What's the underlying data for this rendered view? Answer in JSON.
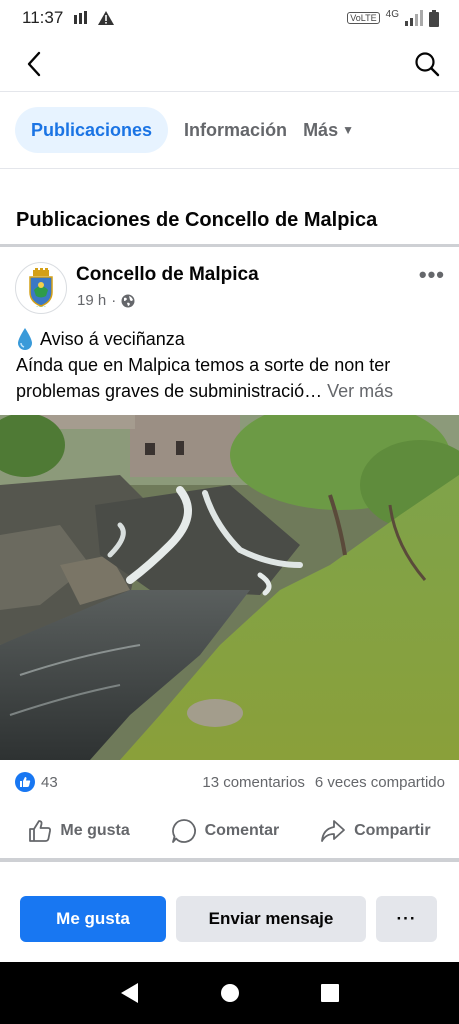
{
  "status_bar": {
    "time": "11:37",
    "volte": "VoLTE",
    "network": "4G"
  },
  "topnav": {
    "back_icon": "back-arrow-icon",
    "search_icon": "search-icon"
  },
  "tabs": [
    {
      "label": "Publicaciones",
      "active": true
    },
    {
      "label": "Información",
      "active": false
    },
    {
      "label": "Más",
      "active": false
    }
  ],
  "section_title": "Publicaciones de Concello de Malpica",
  "post": {
    "page_name": "Concello de Malpica",
    "time_ago": "19 h",
    "separator": "·",
    "line1": "Aviso á veciñanza",
    "line2": "Aínda que en Malpica temos a sorte de non ter",
    "line3": "problemas graves de subministració…",
    "see_more": "Ver más",
    "reaction_count": "43",
    "comments": "13 comentarios",
    "shares": "6 veces compartido",
    "actions": {
      "like": "Me gusta",
      "comment": "Comentar",
      "share": "Compartir"
    }
  },
  "bottom_bar": {
    "like_button": "Me gusta",
    "message_button": "Enviar mensaje",
    "more_button": "···"
  },
  "colors": {
    "accent": "#1877f2",
    "tab_active_bg": "#e7f3ff",
    "secondary_text": "#65676b"
  }
}
